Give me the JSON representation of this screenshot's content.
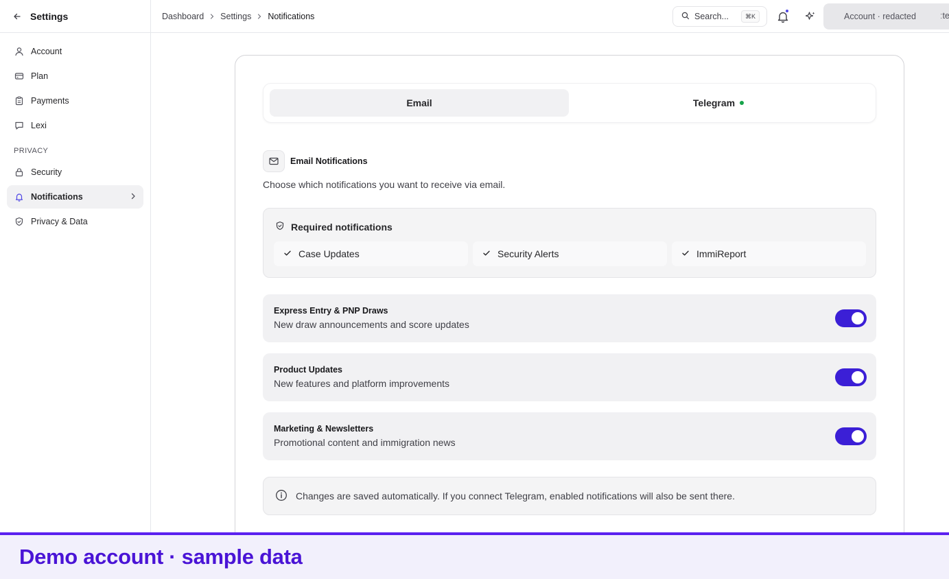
{
  "sidebar": {
    "title": "Settings",
    "items": [
      {
        "label": "Account",
        "icon": "user-icon"
      },
      {
        "label": "Plan",
        "icon": "credit-card-icon"
      },
      {
        "label": "Payments",
        "icon": "clipboard-icon"
      },
      {
        "label": "Lexi",
        "icon": "chat-icon"
      }
    ],
    "section_label": "PRIVACY",
    "privacy_items": [
      {
        "label": "Security",
        "icon": "lock-icon"
      },
      {
        "label": "Notifications",
        "icon": "bell-icon",
        "active": true
      },
      {
        "label": "Privacy & Data",
        "icon": "shield-icon"
      }
    ]
  },
  "header": {
    "breadcrumb": [
      "Dashboard",
      "Settings",
      "Notifications"
    ],
    "search_placeholder": "Search...",
    "search_shortcut": "⌘K",
    "account_label": "Account · redacted",
    "account_trailing": "ːte"
  },
  "tabs": {
    "email": "Email",
    "telegram": "Telegram",
    "telegram_status_color": "#16a34a"
  },
  "section": {
    "title": "Email Notifications",
    "description": "Choose which notifications you want to receive via email."
  },
  "required": {
    "title": "Required notifications",
    "items": [
      "Case Updates",
      "Security Alerts",
      "ImmiReport"
    ]
  },
  "preferences": [
    {
      "title": "Express Entry & PNP Draws",
      "description": "New draw announcements and score updates",
      "enabled": true
    },
    {
      "title": "Product Updates",
      "description": "New features and platform improvements",
      "enabled": true
    },
    {
      "title": "Marketing & Newsletters",
      "description": "Promotional content and immigration news",
      "enabled": true
    }
  ],
  "info_text": "Changes are saved automatically. If you connect Telegram, enabled notifications will also be sent there.",
  "demo_banner": "Demo account · sample data",
  "colors": {
    "accent": "#3b1fd6",
    "banner_border": "#5b21f0",
    "banner_text": "#4a14d6"
  }
}
